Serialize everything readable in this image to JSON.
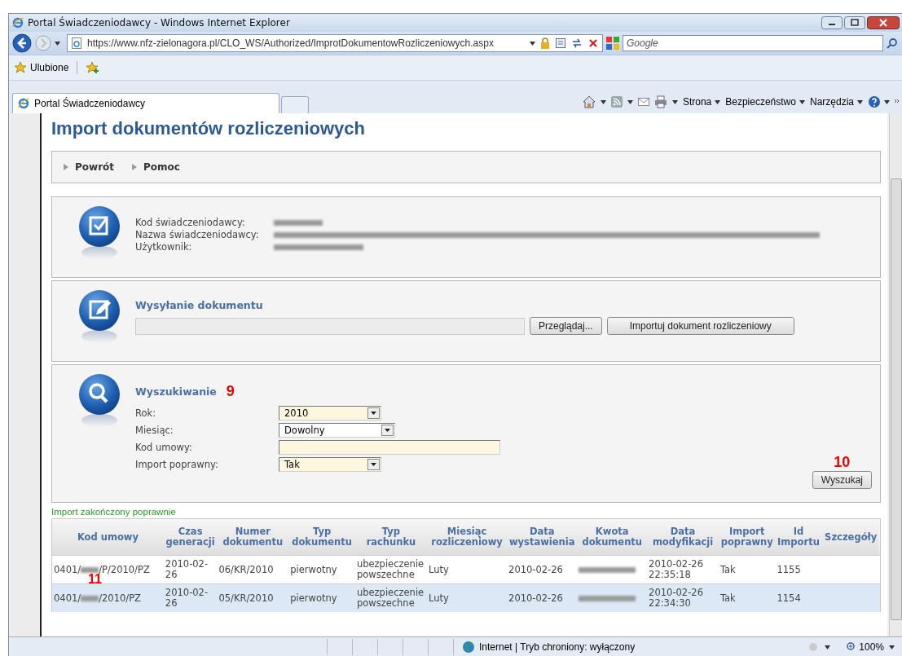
{
  "window": {
    "title": "Portal Świadczeniodawcy - Windows Internet Explorer"
  },
  "address_bar": {
    "url": "https://www.nfz-zielonagora.pl/CLO_WS/Authorized/ImprotDokumentowRozliczeniowych.aspx"
  },
  "search_box": {
    "placeholder": "Google"
  },
  "favorites_bar": {
    "label": "Ulubione"
  },
  "tabs": [
    {
      "label": "Portal Świadczeniodawcy",
      "selected": true
    }
  ],
  "command_bar": [
    "Strona",
    "Bezpieczeństwo",
    "Narzędzia"
  ],
  "page": {
    "title": "Import dokumentów rozliczeniowych",
    "nav_links": [
      "Powrót",
      "Pomoc"
    ],
    "provider_info": {
      "fields": [
        {
          "label": "Kod świadczeniodawcy:"
        },
        {
          "label": "Nazwa świadczeniodawcy:"
        },
        {
          "label": "Użytkownik:"
        }
      ]
    },
    "upload": {
      "title": "Wysyłanie dokumentu",
      "browse_button": "Przeglądaj...",
      "import_button": "Importuj dokument rozliczeniowy"
    },
    "search": {
      "title": "Wyszukiwanie",
      "annotation": "9",
      "fields": [
        {
          "kind": "select",
          "label": "Rok:",
          "value": "2010"
        },
        {
          "kind": "select",
          "label": "Miesiąc:",
          "value": "Dowolny"
        },
        {
          "kind": "text",
          "label": "Kod umowy:"
        },
        {
          "kind": "select",
          "label": "Import poprawny:",
          "value": "Tak"
        }
      ],
      "button": "Wyszukaj",
      "button_annotation": "10"
    },
    "message": "Import zakończony poprawnie",
    "table": {
      "columns": [
        "Kod umowy",
        "Czas generacji",
        "Numer dokumentu",
        "Typ dokumentu",
        "Typ rachunku",
        "Miesiąc rozliczeniowy",
        "Data wystawienia",
        "Kwota dokumentu",
        "Data modyfikacji",
        "Import poprawny",
        "Id Importu",
        "Szczegóły"
      ],
      "annotation": "11",
      "rows": [
        {
          "selected": false,
          "code_prefix": "0401/",
          "code_suffix": "/P/2010/PZ",
          "generated": "2010-02-26",
          "number": "06/KR/2010",
          "doc_type": "pierwotny",
          "account_type": "ubezpieczenie powszechne",
          "month": "Luty",
          "issued": "2010-02-26",
          "modified": "2010-02-26 22:35:18",
          "import_ok": "Tak",
          "import_id": "1155"
        },
        {
          "selected": true,
          "code_prefix": "0401/",
          "code_suffix": "/2010/PZ",
          "generated": "2010-02-26",
          "number": "05/KR/2010",
          "doc_type": "pierwotny",
          "account_type": "ubezpieczenie powszechne",
          "month": "Luty",
          "issued": "2010-02-26",
          "modified": "2010-02-26 22:34:30",
          "import_ok": "Tak",
          "import_id": "1154"
        }
      ]
    }
  },
  "status_bar": {
    "zone": "Internet | Tryb chroniony: wyłączony",
    "zoom": "100%"
  }
}
